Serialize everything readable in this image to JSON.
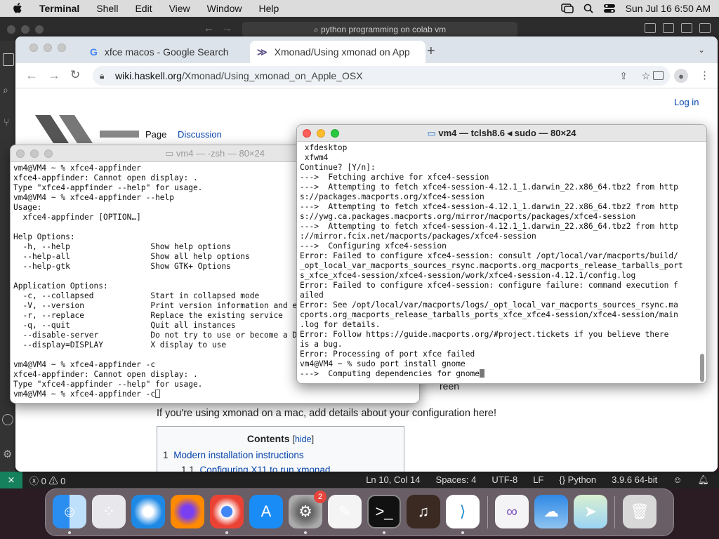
{
  "menubar": {
    "app": "Terminal",
    "items": [
      "Shell",
      "Edit",
      "View",
      "Window",
      "Help"
    ],
    "clock": "Sun Jul 16  6:50 AM"
  },
  "vscode": {
    "search": "python programming on colab vm",
    "status": {
      "problems": "0",
      "warnings": "0",
      "position": "Ln 10, Col 14",
      "spaces": "Spaces: 4",
      "encoding": "UTF-8",
      "eol": "LF",
      "language": "Python",
      "interpreter": "3.9.6 64-bit"
    }
  },
  "browser": {
    "tabs": [
      {
        "title": "xfce macos - Google Search",
        "icon": "google-icon"
      },
      {
        "title": "Xmonad/Using xmonad on App",
        "icon": "haskell-icon"
      }
    ],
    "url_host": "wiki.haskell.org",
    "url_path": "/Xmonad/Using_xmonad_on_Apple_OSX",
    "page": {
      "login": "Log in",
      "tab_page": "Page",
      "tab_discussion": "Discussion",
      "fragment_text": "reen",
      "intro": "If you're using xmonad on a mac, add details about your configuration here!",
      "contents_title": "Contents",
      "contents_hide": "hide",
      "toc": [
        {
          "num": "1",
          "text": "Modern installation instructions"
        },
        {
          "num": "1.1",
          "text": "Configuring X11 to run xmonad"
        }
      ]
    }
  },
  "term_left": {
    "title": "vm4 — -zsh — 80×24",
    "lines": [
      "vm4@VM4 ~ % xfce4-appfinder",
      "xfce4-appfinder: Cannot open display: .",
      "Type \"xfce4-appfinder --help\" for usage.",
      "vm4@VM4 ~ % xfce4-appfinder --help",
      "Usage:",
      "  xfce4-appfinder [OPTION…]",
      "",
      "Help Options:",
      "  -h, --help                 Show help options",
      "  --help-all                 Show all help options",
      "  --help-gtk                 Show GTK+ Options",
      "",
      "Application Options:",
      "  -c, --collapsed            Start in collapsed mode",
      "  -V, --version              Print version information and e",
      "  -r, --replace              Replace the existing service",
      "  -q, --quit                 Quit all instances",
      "  --disable-server           Do not try to use or become a D",
      "  --display=DISPLAY          X display to use",
      "",
      "vm4@VM4 ~ % xfce4-appfinder -c",
      "xfce4-appfinder: Cannot open display: .",
      "Type \"xfce4-appfinder --help\" for usage.",
      "vm4@VM4 ~ % xfce4-appfinder -c"
    ]
  },
  "term_right": {
    "title": "vm4 — tclsh8.6 ◂ sudo — 80×24",
    "lines": [
      " xfdesktop",
      " xfwm4",
      "Continue? [Y/n]:",
      "--->  Fetching archive for xfce4-session",
      "--->  Attempting to fetch xfce4-session-4.12.1_1.darwin_22.x86_64.tbz2 from http",
      "s://packages.macports.org/xfce4-session",
      "--->  Attempting to fetch xfce4-session-4.12.1_1.darwin_22.x86_64.tbz2 from http",
      "s://ywg.ca.packages.macports.org/mirror/macports/packages/xfce4-session",
      "--->  Attempting to fetch xfce4-session-4.12.1_1.darwin_22.x86_64.tbz2 from http",
      "://mirror.fcix.net/macports/packages/xfce4-session",
      "--->  Configuring xfce4-session",
      "Error: Failed to configure xfce4-session: consult /opt/local/var/macports/build/",
      "_opt_local_var_macports_sources_rsync.macports.org_macports_release_tarballs_port",
      "s_xfce_xfce4-session/xfce4-session/work/xfce4-session-4.12.1/config.log",
      "Error: Failed to configure xfce4-session: configure failure: command execution f",
      "ailed",
      "Error: See /opt/local/var/macports/logs/_opt_local_var_macports_sources_rsync.ma",
      "cports.org_macports_release_tarballs_ports_xfce_xfce4-session/xfce4-session/main",
      ".log for details.",
      "Error: Follow https://guide.macports.org/#project.tickets if you believe there",
      "is a bug.",
      "Error: Processing of port xfce failed",
      "vm4@VM4 ~ % sudo port install gnome",
      "--->  Computing dependencies for gnome"
    ]
  },
  "dock": {
    "badge": "2",
    "apps": [
      "finder-icon",
      "launchpad-icon",
      "safari-icon",
      "firefox-icon",
      "chrome-icon",
      "app-store-icon",
      "system-settings-icon",
      "textedit-icon",
      "terminal-icon",
      "garageband-icon",
      "vscode-icon",
      "visual-studio-icon",
      "weather-icon",
      "maps-icon",
      "trash-icon"
    ]
  }
}
